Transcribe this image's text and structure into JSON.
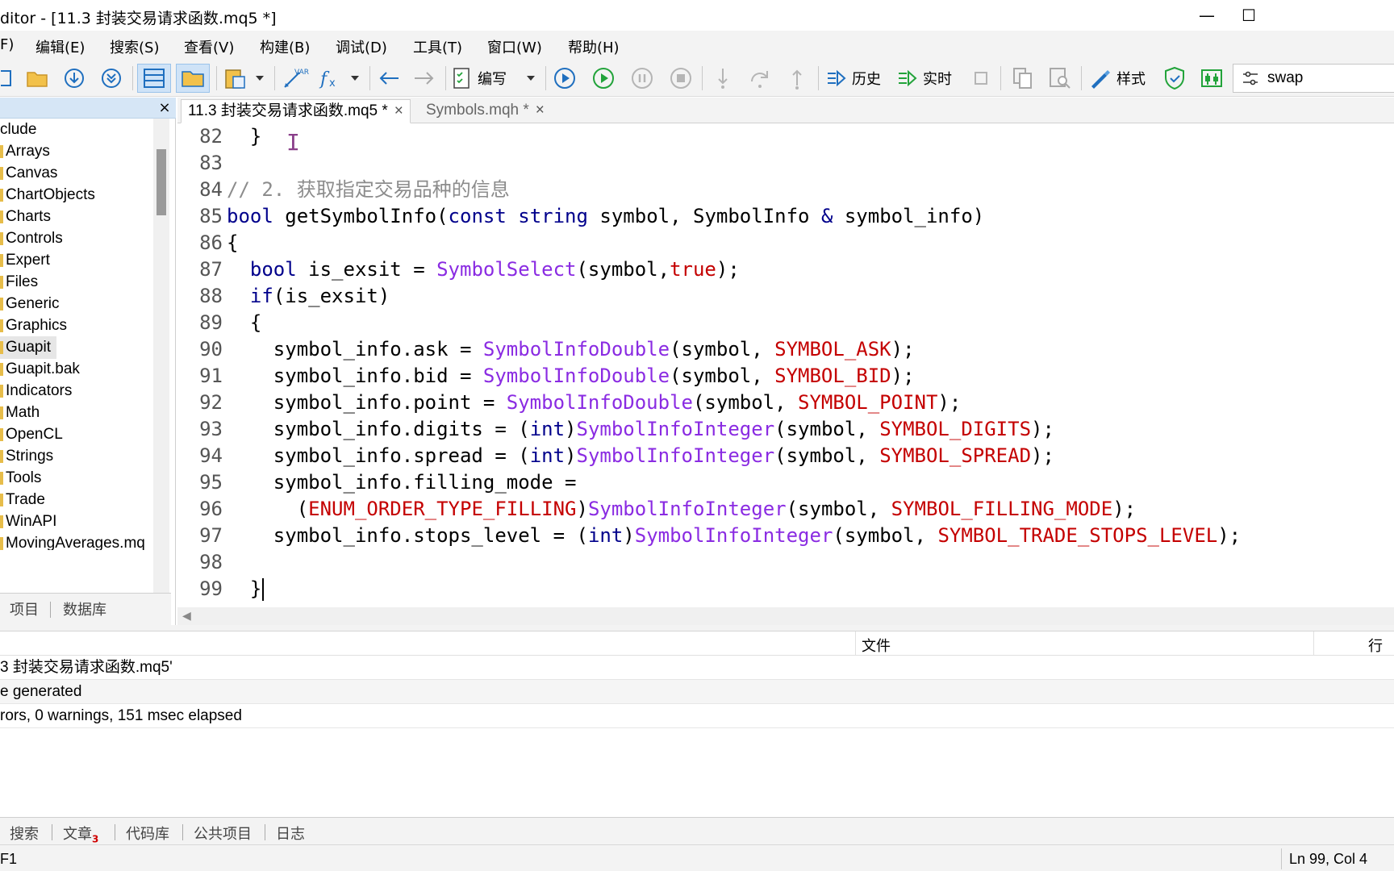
{
  "window": {
    "title": "ditor - [11.3 封装交易请求函数.mq5 *]",
    "minimize_glyph": "—",
    "maximize_glyph": "☐"
  },
  "menu": [
    {
      "label": "F)"
    },
    {
      "label": "编辑(E)"
    },
    {
      "label": "搜索(S)"
    },
    {
      "label": "查看(V)"
    },
    {
      "label": "构建(B)"
    },
    {
      "label": "调试(D)"
    },
    {
      "label": "工具(T)"
    },
    {
      "label": "窗口(W)"
    },
    {
      "label": "帮助(H)"
    }
  ],
  "toolbar": {
    "compile_label": "编写",
    "history_label": "历史",
    "realtime_label": "实时",
    "styler_label": "样式",
    "var_label": "VAR",
    "search_value": "swap",
    "accent_color": "#1f6fbf",
    "play_color": "#22a33a"
  },
  "navigator": {
    "close_glyph": "×",
    "items": [
      {
        "label": "clude"
      },
      {
        "label": "Arrays"
      },
      {
        "label": "Canvas"
      },
      {
        "label": "ChartObjects"
      },
      {
        "label": "Charts"
      },
      {
        "label": "Controls"
      },
      {
        "label": "Expert"
      },
      {
        "label": "Files"
      },
      {
        "label": "Generic"
      },
      {
        "label": "Graphics"
      },
      {
        "label": "Guapit"
      },
      {
        "label": "Guapit.bak"
      },
      {
        "label": "Indicators"
      },
      {
        "label": "Math"
      },
      {
        "label": "OpenCL"
      },
      {
        "label": "Strings"
      },
      {
        "label": "Tools"
      },
      {
        "label": "Trade"
      },
      {
        "label": "WinAPI"
      },
      {
        "label": "MovingAverages.mq"
      }
    ],
    "selected_item": "Guapit",
    "tabs": [
      {
        "label": "项目"
      },
      {
        "label": "数据库"
      }
    ]
  },
  "editor_tabs": [
    {
      "label": "11.3 封装交易请求函数.mq5 *",
      "close": "×"
    },
    {
      "label": "Symbols.mqh *",
      "close": "×"
    }
  ],
  "code_lines": [
    {
      "n": "82",
      "tokens": [
        {
          "t": "  }",
          "c": "p"
        }
      ]
    },
    {
      "n": "83",
      "tokens": []
    },
    {
      "n": "84",
      "tokens": [
        {
          "t": "// 2. 获取指定交易品种的信息",
          "c": "cm"
        }
      ]
    },
    {
      "n": "85",
      "tokens": [
        {
          "t": "bool",
          "c": "kw"
        },
        {
          "t": " getSymbolInfo(",
          "c": "p"
        },
        {
          "t": "const",
          "c": "kw"
        },
        {
          "t": " ",
          "c": "p"
        },
        {
          "t": "string",
          "c": "kw"
        },
        {
          "t": " symbol, SymbolInfo ",
          "c": "p"
        },
        {
          "t": "&",
          "c": "kw"
        },
        {
          "t": " symbol_info)",
          "c": "p"
        }
      ]
    },
    {
      "n": "86",
      "tokens": [
        {
          "t": "{",
          "c": "p"
        }
      ]
    },
    {
      "n": "87",
      "tokens": [
        {
          "t": "  ",
          "c": "p"
        },
        {
          "t": "bool",
          "c": "kw"
        },
        {
          "t": " is_exsit = ",
          "c": "p"
        },
        {
          "t": "SymbolSelect",
          "c": "fn"
        },
        {
          "t": "(symbol,",
          "c": "p"
        },
        {
          "t": "true",
          "c": "ct"
        },
        {
          "t": ");",
          "c": "p"
        }
      ]
    },
    {
      "n": "88",
      "tokens": [
        {
          "t": "  ",
          "c": "p"
        },
        {
          "t": "if",
          "c": "kw"
        },
        {
          "t": "(is_exsit)",
          "c": "p"
        }
      ]
    },
    {
      "n": "89",
      "tokens": [
        {
          "t": "  {",
          "c": "p"
        }
      ]
    },
    {
      "n": "90",
      "tokens": [
        {
          "t": "    symbol_info.ask = ",
          "c": "p"
        },
        {
          "t": "SymbolInfoDouble",
          "c": "fn"
        },
        {
          "t": "(symbol, ",
          "c": "p"
        },
        {
          "t": "SYMBOL_ASK",
          "c": "ct"
        },
        {
          "t": ");",
          "c": "p"
        }
      ]
    },
    {
      "n": "91",
      "tokens": [
        {
          "t": "    symbol_info.bid = ",
          "c": "p"
        },
        {
          "t": "SymbolInfoDouble",
          "c": "fn"
        },
        {
          "t": "(symbol, ",
          "c": "p"
        },
        {
          "t": "SYMBOL_BID",
          "c": "ct"
        },
        {
          "t": ");",
          "c": "p"
        }
      ]
    },
    {
      "n": "92",
      "tokens": [
        {
          "t": "    symbol_info.point = ",
          "c": "p"
        },
        {
          "t": "SymbolInfoDouble",
          "c": "fn"
        },
        {
          "t": "(symbol, ",
          "c": "p"
        },
        {
          "t": "SYMBOL_POINT",
          "c": "ct"
        },
        {
          "t": ");",
          "c": "p"
        }
      ]
    },
    {
      "n": "93",
      "tokens": [
        {
          "t": "    symbol_info.digits = (",
          "c": "p"
        },
        {
          "t": "int",
          "c": "kw"
        },
        {
          "t": ")",
          "c": "p"
        },
        {
          "t": "SymbolInfoInteger",
          "c": "fn"
        },
        {
          "t": "(symbol, ",
          "c": "p"
        },
        {
          "t": "SYMBOL_DIGITS",
          "c": "ct"
        },
        {
          "t": ");",
          "c": "p"
        }
      ]
    },
    {
      "n": "94",
      "tokens": [
        {
          "t": "    symbol_info.spread = (",
          "c": "p"
        },
        {
          "t": "int",
          "c": "kw"
        },
        {
          "t": ")",
          "c": "p"
        },
        {
          "t": "SymbolInfoInteger",
          "c": "fn"
        },
        {
          "t": "(symbol, ",
          "c": "p"
        },
        {
          "t": "SYMBOL_SPREAD",
          "c": "ct"
        },
        {
          "t": ");",
          "c": "p"
        }
      ]
    },
    {
      "n": "95",
      "tokens": [
        {
          "t": "    symbol_info.filling_mode =",
          "c": "p"
        }
      ]
    },
    {
      "n": "96",
      "tokens": [
        {
          "t": "      (",
          "c": "p"
        },
        {
          "t": "ENUM_ORDER_TYPE_FILLING",
          "c": "ct"
        },
        {
          "t": ")",
          "c": "p"
        },
        {
          "t": "SymbolInfoInteger",
          "c": "fn"
        },
        {
          "t": "(symbol, ",
          "c": "p"
        },
        {
          "t": "SYMBOL_FILLING_MODE",
          "c": "ct"
        },
        {
          "t": ");",
          "c": "p"
        }
      ]
    },
    {
      "n": "97",
      "tokens": [
        {
          "t": "    symbol_info.stops_level = (",
          "c": "p"
        },
        {
          "t": "int",
          "c": "kw"
        },
        {
          "t": ")",
          "c": "p"
        },
        {
          "t": "SymbolInfoInteger",
          "c": "fn"
        },
        {
          "t": "(symbol, ",
          "c": "p"
        },
        {
          "t": "SYMBOL_TRADE_STOPS_LEVEL",
          "c": "ct"
        },
        {
          "t": ");",
          "c": "p"
        }
      ]
    },
    {
      "n": "98",
      "tokens": []
    },
    {
      "n": "99",
      "tokens": [
        {
          "t": "  }",
          "c": "p"
        }
      ],
      "caret": true
    }
  ],
  "output": {
    "col_file": "文件",
    "col_line": "行",
    "rows": [
      {
        "text": "3 封装交易请求函数.mq5'"
      },
      {
        "text": "e generated"
      },
      {
        "text": "rors, 0 warnings, 151 msec elapsed"
      }
    ]
  },
  "bottom_tabs": [
    {
      "label": "搜索",
      "badge": ""
    },
    {
      "label": "文章",
      "badge": "3"
    },
    {
      "label": "代码库",
      "badge": ""
    },
    {
      "label": "公共项目",
      "badge": ""
    },
    {
      "label": "日志",
      "badge": ""
    }
  ],
  "status": {
    "left": "F1",
    "position": "Ln 99, Col 4"
  }
}
